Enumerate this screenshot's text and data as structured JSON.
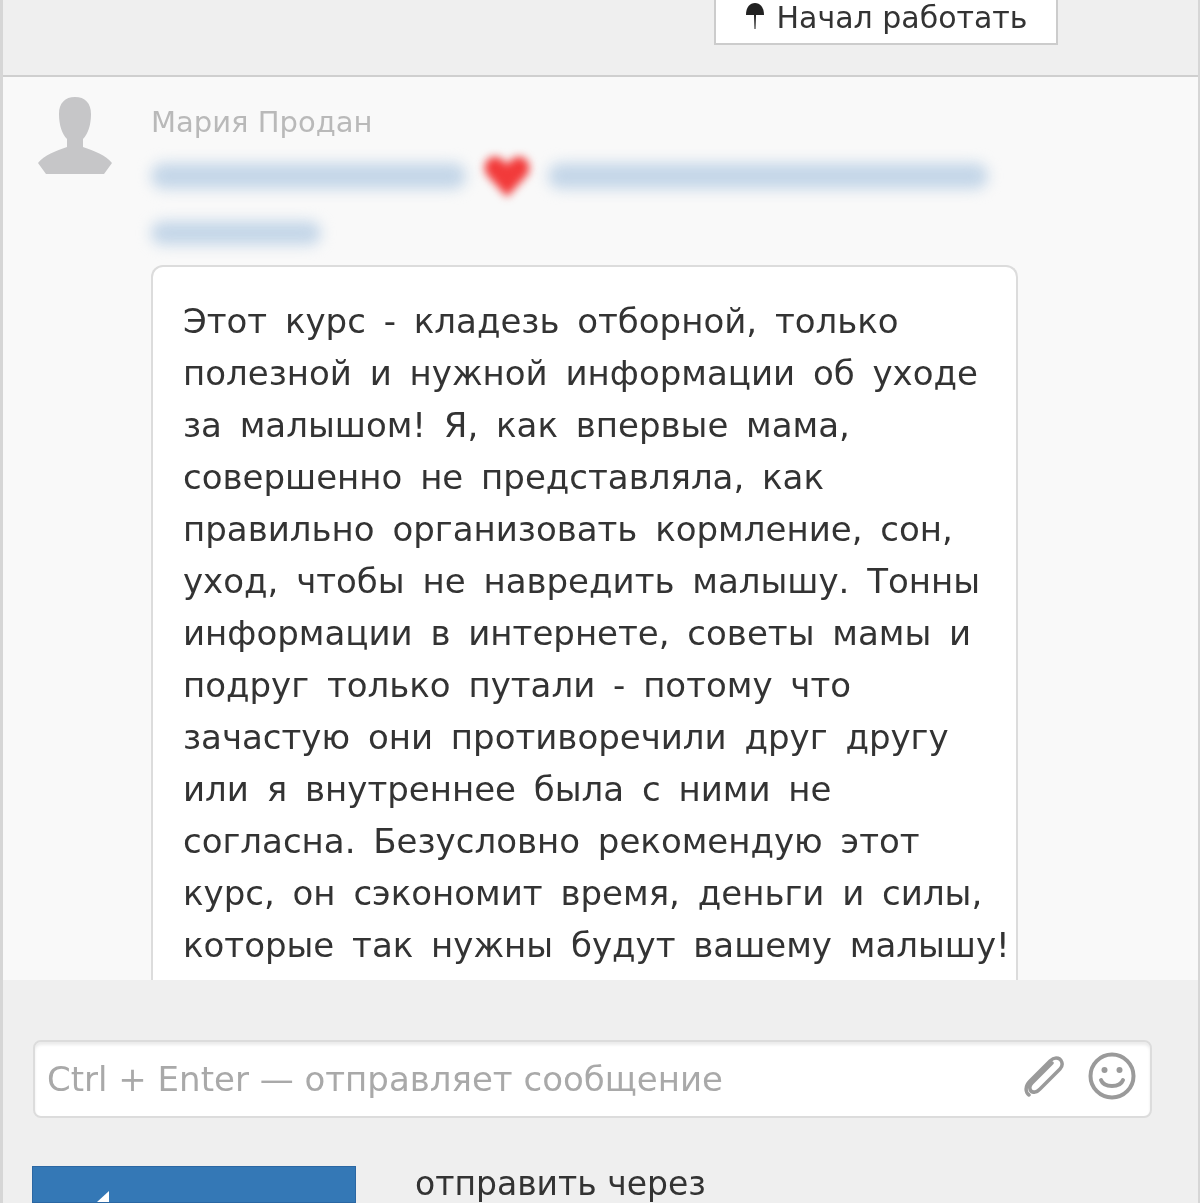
{
  "top_bar": {
    "button": {
      "label": "Начал работать"
    }
  },
  "message": {
    "author": "Мария Продан",
    "text": "Этот курс - кладезь отборной, только полезной и нужной информации об уходе за малышом! Я, как впервые мама, совершенно не представляла, как правильно организовать кормление, сон, уход, чтобы не навредить малышу. Тонны информации в интернете, советы мамы и подруг только путали - потому что зачастую они противоречили друг другу или я внутреннее была с ними не согласна. Безусловно рекомендую этот курс, он сэкономит время, деньги и силы, которые так нужны будут вашему малышу!"
  },
  "composer": {
    "placeholder": "Ctrl + Enter — отправляет сообщение",
    "send_via_label": "отправить через"
  }
}
